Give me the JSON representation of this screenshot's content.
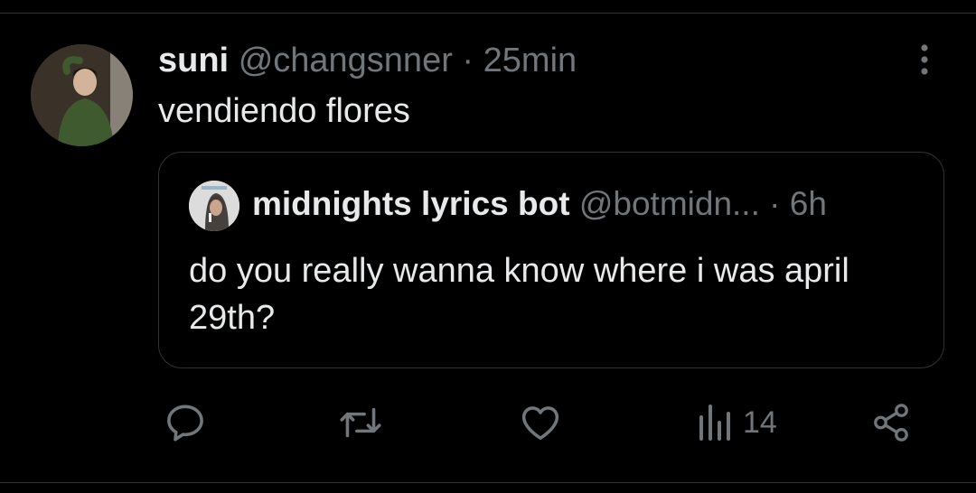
{
  "tweet": {
    "display_name": "suni",
    "handle": "@changsnner",
    "separator": "·",
    "time": "25min",
    "text": "vendiendo flores"
  },
  "quoted_tweet": {
    "display_name": "midnights lyrics bot",
    "handle": "@botmidn...",
    "separator": "·",
    "time": "6h",
    "text": "do you really wanna know where i was april 29th?"
  },
  "actions": {
    "reply_icon": "reply-bubble",
    "retweet_icon": "retweet-arrows",
    "like_icon": "heart",
    "views_icon": "bar-chart",
    "views_count": "14",
    "share_icon": "share-nodes"
  },
  "colors": {
    "background": "#000000",
    "text_primary": "#e7e9ea",
    "text_secondary": "#71767b",
    "border": "#2f3336"
  }
}
